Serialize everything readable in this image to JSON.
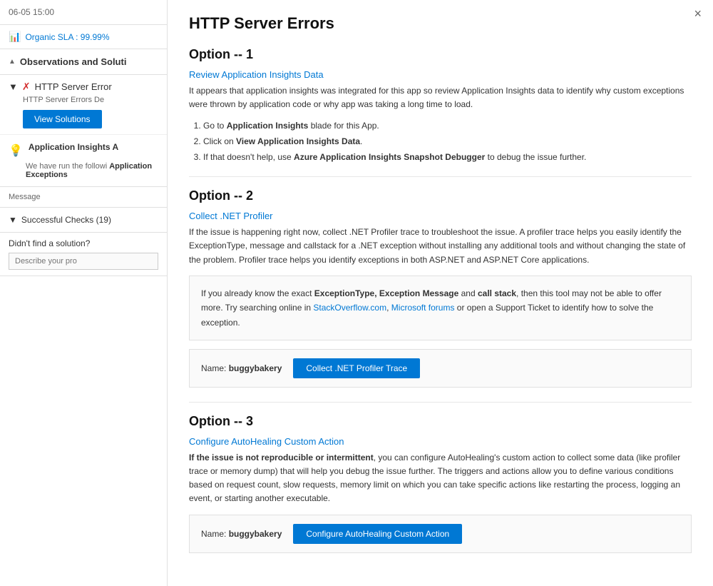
{
  "left": {
    "header_date": "06-05 15:00",
    "sla_label": "Organic SLA : 99.99%",
    "observations_title": "Observations and Soluti",
    "http_error_title": "HTTP Server Error",
    "http_error_desc": "HTTP Server Errors De",
    "view_solutions_btn": "View Solutions",
    "app_insights_title": "Application Insights A",
    "app_insights_desc_prefix": "We have run the followi",
    "app_insights_desc_bold": "Application Exceptions",
    "message_label": "Message",
    "successful_checks": "Successful Checks (19)",
    "solution_label": "Didn't find a solution?",
    "describe_placeholder": "Describe your pro"
  },
  "right": {
    "close_label": "×",
    "main_title": "HTTP Server Errors",
    "option1": {
      "title": "Option -- 1",
      "subtitle": "Review Application Insights Data",
      "desc": "It appears that application insights was integrated for this app so review Application Insights data to identify why custom exceptions were thrown by application code or why app was taking a long time to load.",
      "steps": [
        {
          "num": "1.",
          "text_prefix": "Go to ",
          "bold": "Application Insights",
          "text_suffix": " blade for this App."
        },
        {
          "num": "2.",
          "text_prefix": "Click on ",
          "bold": "View Application Insights Data",
          "text_suffix": "."
        },
        {
          "num": "3.",
          "text_prefix": "If that doesn't help, use ",
          "bold": "Azure Application Insights Snapshot Debugger",
          "text_suffix": " to debug the issue further."
        }
      ]
    },
    "option2": {
      "title": "Option -- 2",
      "subtitle": "Collect .NET Profiler",
      "desc": "If the issue is happening right now, collect .NET Profiler trace to troubleshoot the issue. A profiler trace helps you easily identify the ExceptionType, message and callstack for a .NET exception without installing any additional tools and without changing the state of the problem. Profiler trace helps you identify exceptions in both ASP.NET and ASP.NET Core applications.",
      "info_box": {
        "text1": "If you already know the exact ",
        "bold1": "ExceptionType, Exception Message",
        "text2": " and ",
        "bold2": "call stack",
        "text3": ", then this tool may not be able to offer more. Try searching online in ",
        "link1": "StackOverflow.com",
        "text4": ", ",
        "link2": "Microsoft forums",
        "text5": " or open a Support Ticket to identify how to solve the exception."
      },
      "action_name_prefix": "Name: ",
      "action_name_value": "buggybakery",
      "action_btn": "Collect .NET Profiler Trace"
    },
    "option3": {
      "title": "Option -- 3",
      "subtitle": "Configure AutoHealing Custom Action",
      "desc_bold_prefix": "If the issue is not reproducible or intermittent",
      "desc_rest": ", you can configure AutoHealing's custom action to collect some data (like profiler trace or memory dump) that will help you debug the issue further. The triggers and actions allow you to define various conditions based on request count, slow requests, memory limit on which you can take specific actions like restarting the process, logging an event, or starting another executable.",
      "action_name_prefix": "Name: ",
      "action_name_value": "buggybakery",
      "action_btn": "Configure AutoHealing Custom Action"
    }
  }
}
